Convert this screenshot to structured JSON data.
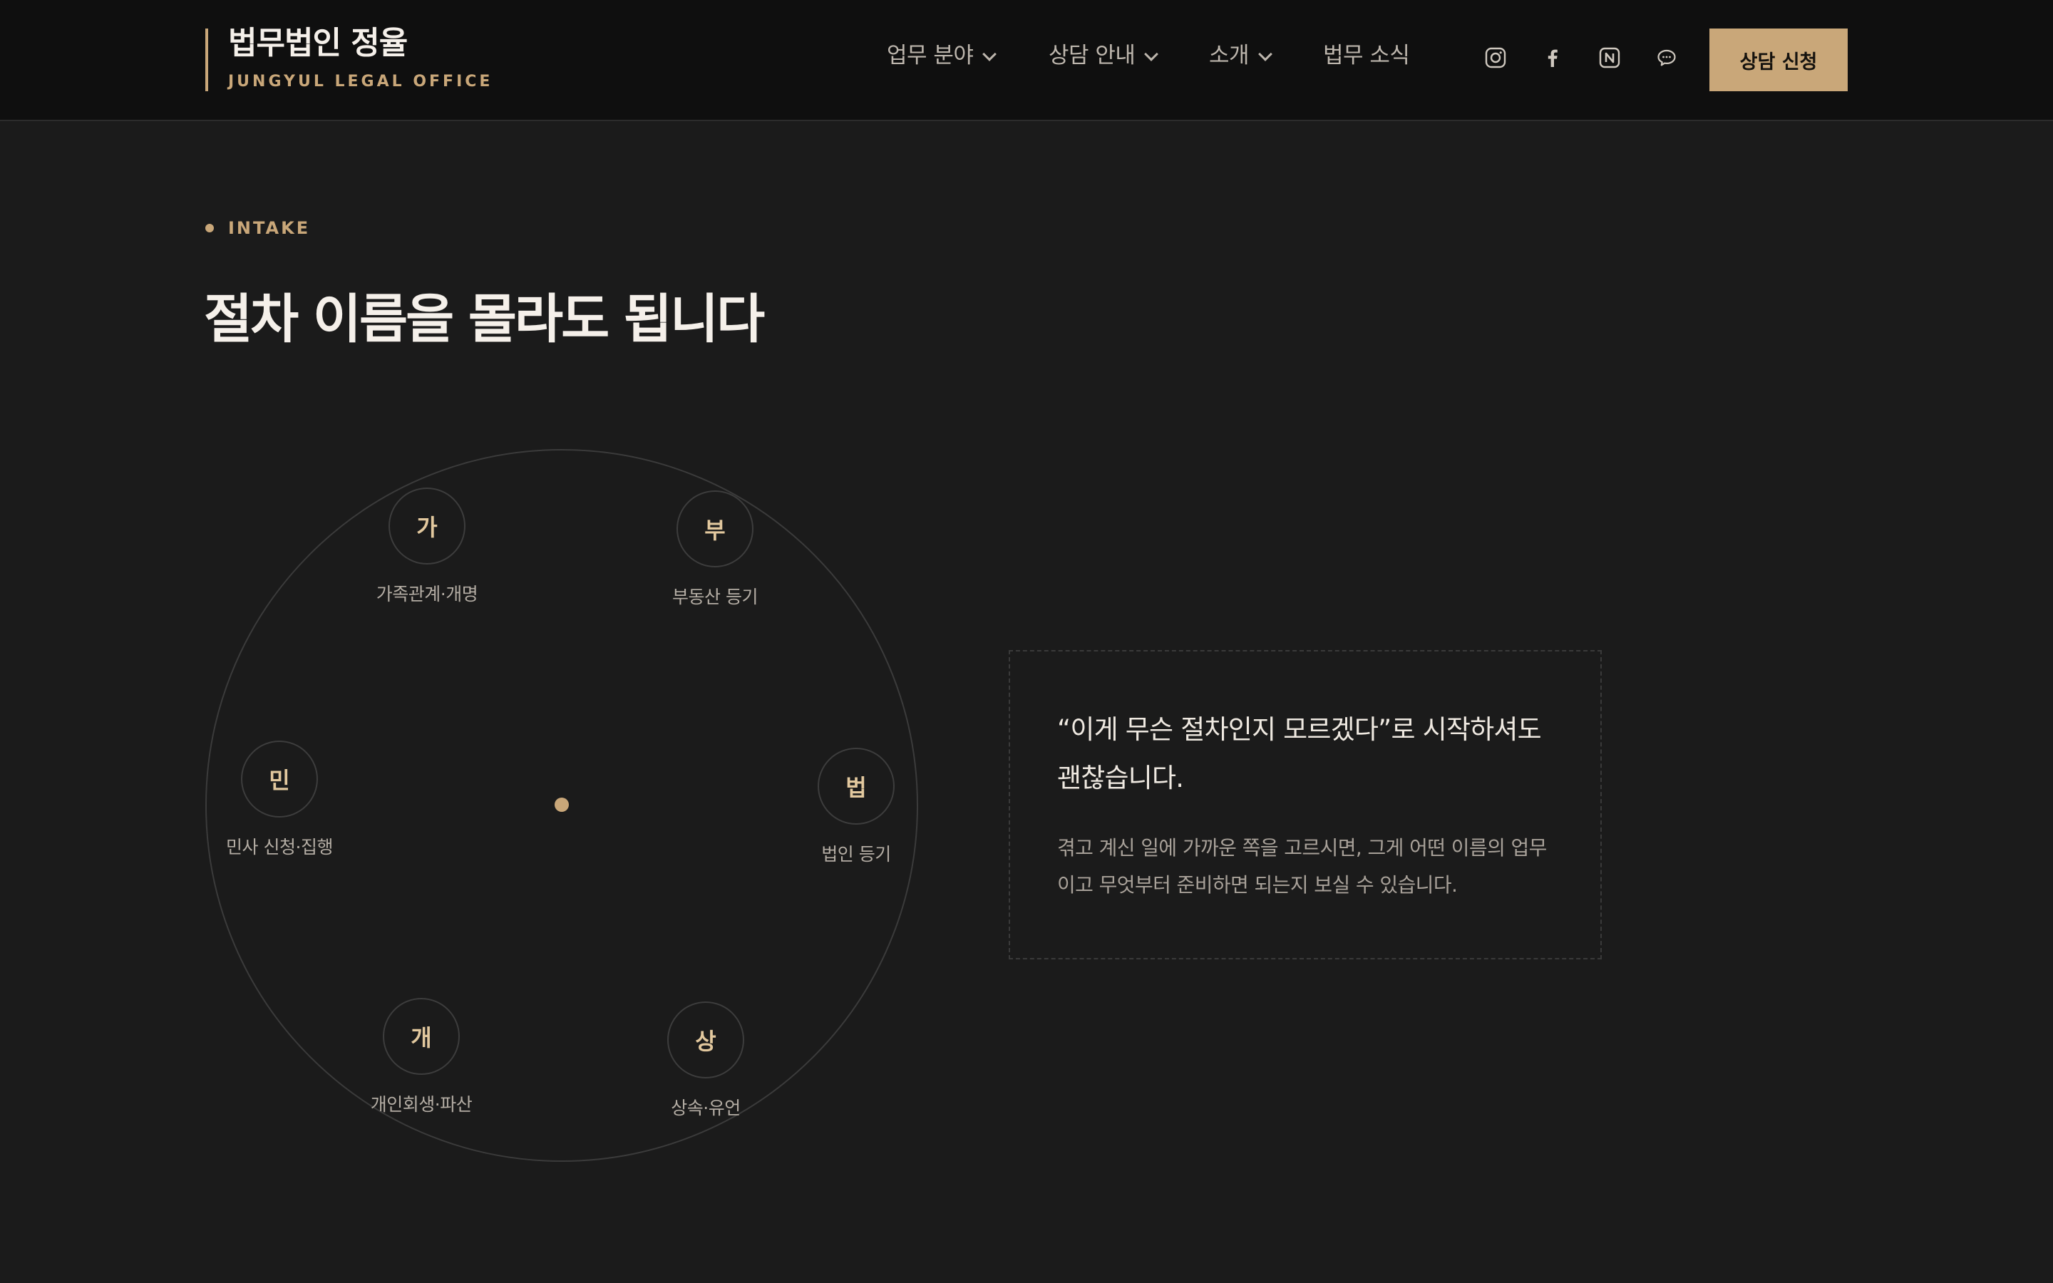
{
  "header": {
    "brand_title": "법무법인 정율",
    "brand_subtitle": "JUNGYUL LEGAL OFFICE",
    "nav": [
      {
        "label": "업무 분야",
        "has_dropdown": true
      },
      {
        "label": "상담 안내",
        "has_dropdown": true
      },
      {
        "label": "소개",
        "has_dropdown": true
      },
      {
        "label": "법무 소식",
        "has_dropdown": false
      }
    ],
    "social_icons": [
      "instagram-icon",
      "facebook-icon",
      "naver-blog-icon",
      "kakaotalk-icon"
    ],
    "cta_label": "상담 신청"
  },
  "section": {
    "eyebrow": "INTAKE",
    "heading": "절차 이름을 몰라도 됩니다",
    "nodes": [
      {
        "char": "가",
        "label": "가족관계·개명"
      },
      {
        "char": "부",
        "label": "부동산 등기"
      },
      {
        "char": "민",
        "label": "민사 신청·집행"
      },
      {
        "char": "법",
        "label": "법인 등기"
      },
      {
        "char": "개",
        "label": "개인회생·파산"
      },
      {
        "char": "상",
        "label": "상속·유언"
      }
    ],
    "info": {
      "lead": "“이게 무슨 절차인지 모르겠다”로 시작하셔도 괜찮습니다.",
      "body": "겪고 계신 일에 가까운 쪽을 고르시면, 그게 어떤 이름의 업무이고 무엇부터 준비하면 되는지 보실 수 있습니다."
    }
  },
  "colors": {
    "background": "#1b1b1b",
    "header_background": "#0f0f0f",
    "accent": "#c9a779"
  }
}
